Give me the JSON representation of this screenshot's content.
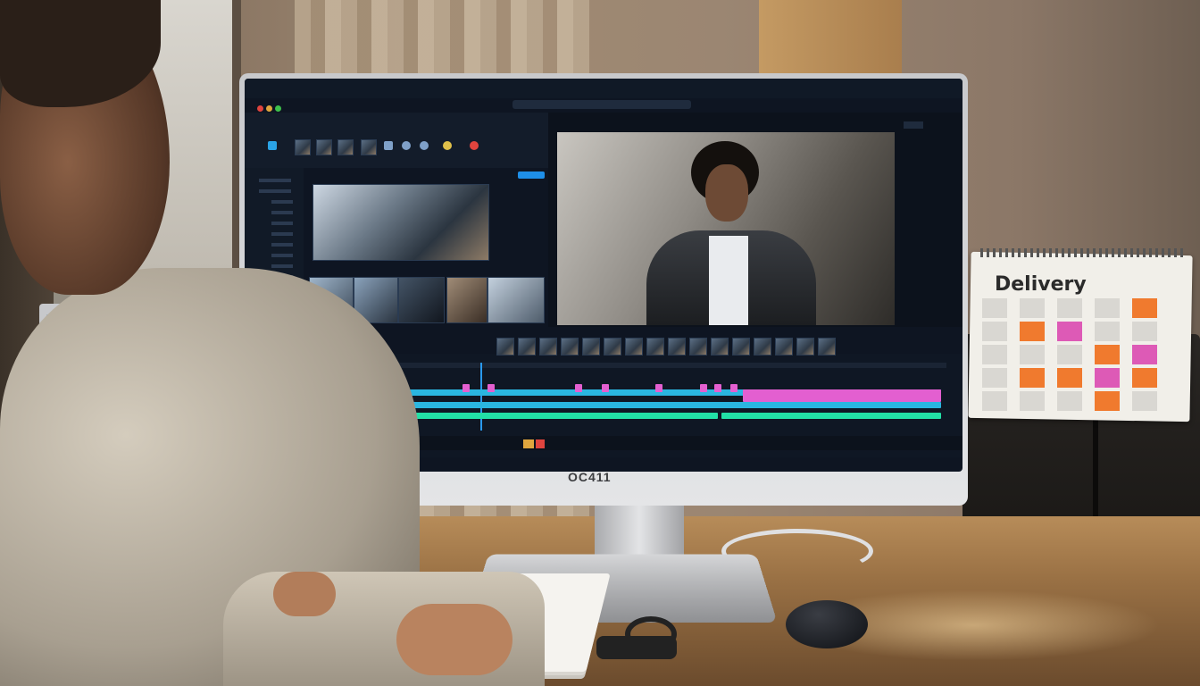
{
  "calendar": {
    "title": "Delivery",
    "colors": {
      "orange": "#f07a2e",
      "pink": "#dd5ab6",
      "grey": "#d9d7d2"
    }
  },
  "monitor": {
    "brand": "OC411"
  },
  "editor": {
    "colors": {
      "background": "#0e1522",
      "panel": "#141d2b",
      "accent_blue": "#1e8fe8",
      "clip_pink": "#e35fd0",
      "clip_cyan": "#2ab6e0",
      "clip_green": "#22e0a6"
    },
    "icons": [
      "search-icon",
      "settings-icon",
      "share-icon",
      "play-icon",
      "scissors-icon",
      "folder-icon"
    ]
  }
}
